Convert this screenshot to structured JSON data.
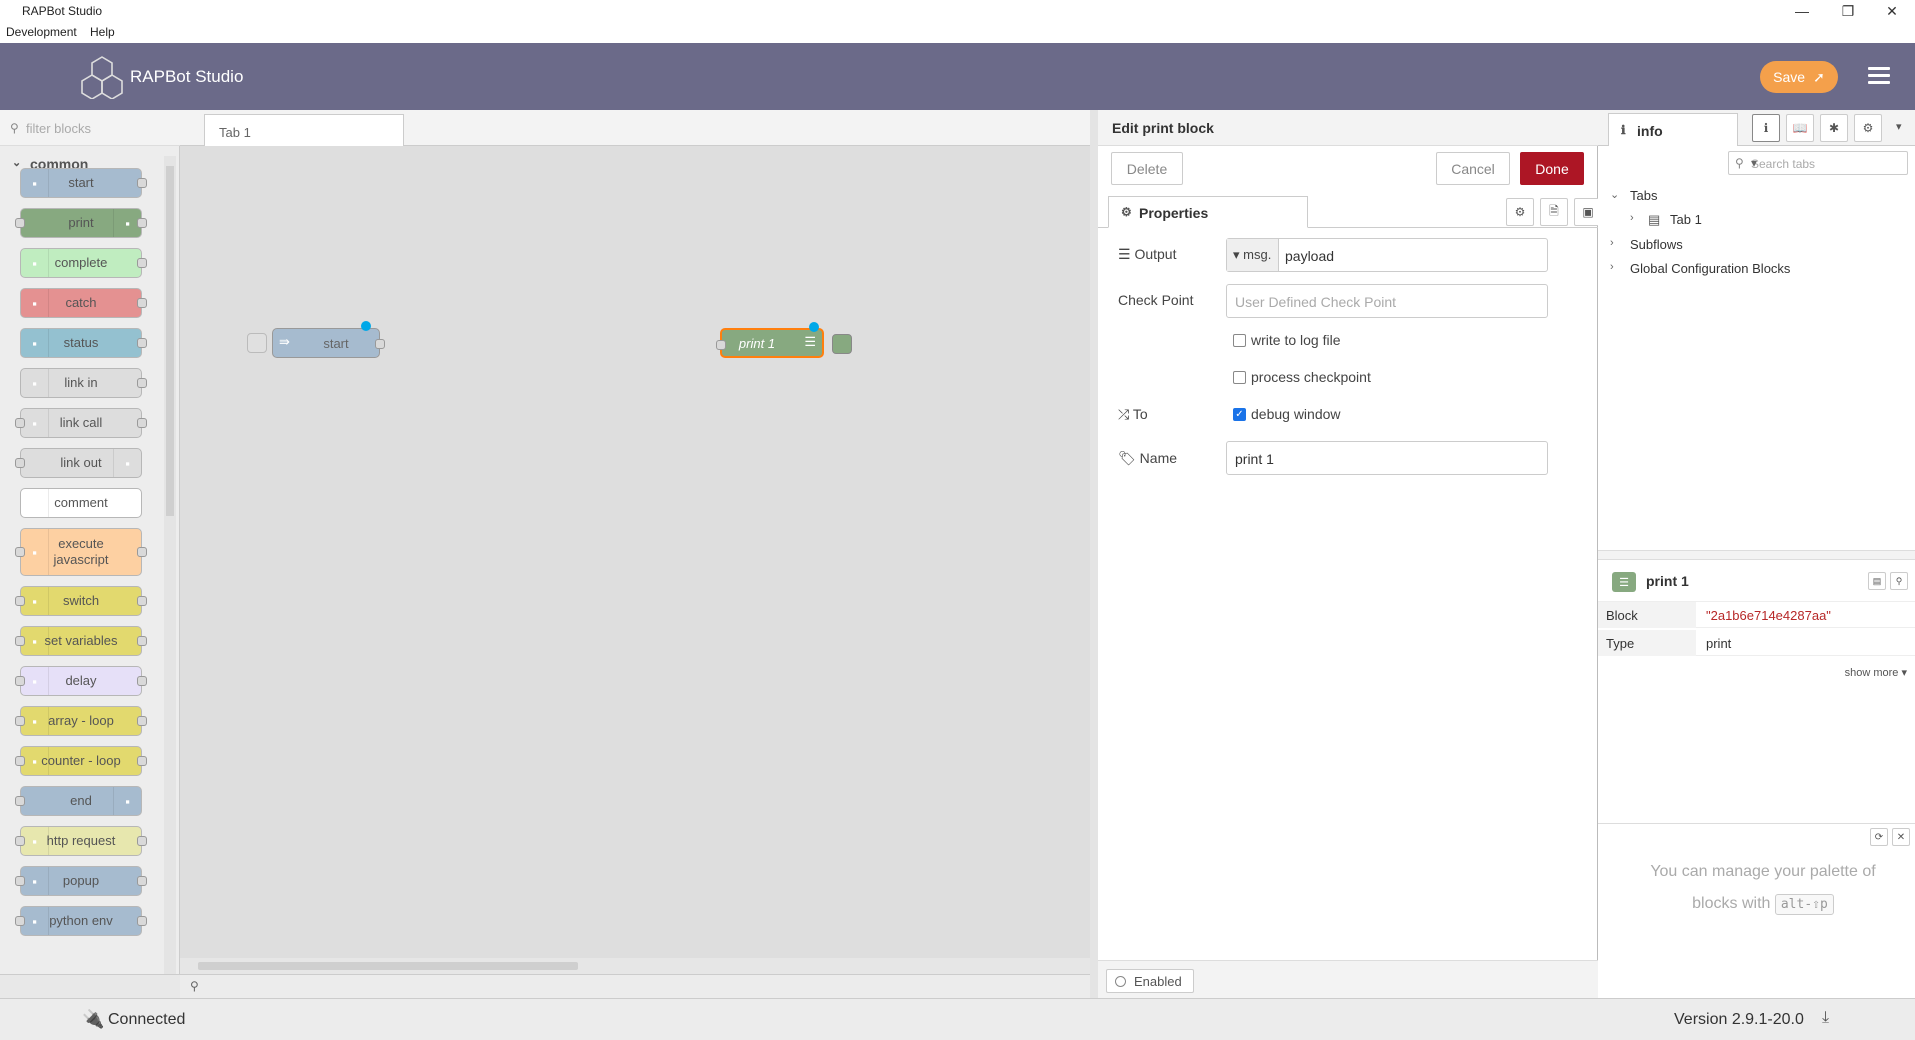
{
  "window": {
    "title": "RAPBot Studio",
    "minimize": "—",
    "restore": "❐",
    "close": "✕"
  },
  "menubar": {
    "items": [
      "Development",
      "Help"
    ]
  },
  "header": {
    "app_title": "RAPBot Studio",
    "save_label": "Save"
  },
  "palette": {
    "filter_placeholder": "filter blocks",
    "category": "common",
    "nodes": [
      {
        "label": "start",
        "color": "#a6bbcf"
      },
      {
        "label": "print",
        "color": "#87a980"
      },
      {
        "label": "complete",
        "color": "#c0edc0"
      },
      {
        "label": "catch",
        "color": "#e49191"
      },
      {
        "label": "status",
        "color": "#94c1d0"
      },
      {
        "label": "link in",
        "color": "#dddddd"
      },
      {
        "label": "link call",
        "color": "#dddddd"
      },
      {
        "label": "link out",
        "color": "#dddddd"
      },
      {
        "label": "comment",
        "color": "#ffffff"
      },
      {
        "label": "execute javascript",
        "color": "#fdd0a2"
      },
      {
        "label": "switch",
        "color": "#e2d96e"
      },
      {
        "label": "set variables",
        "color": "#e2d96e"
      },
      {
        "label": "delay",
        "color": "#e6e0f8"
      },
      {
        "label": "array - loop",
        "color": "#e2d96e"
      },
      {
        "label": "counter - loop",
        "color": "#e2d96e"
      },
      {
        "label": "end",
        "color": "#a6bbcf"
      },
      {
        "label": "http request",
        "color": "#e7e7ae"
      },
      {
        "label": "popup",
        "color": "#a6bbcf"
      },
      {
        "label": "python env",
        "color": "#a6bbcf"
      }
    ]
  },
  "workspace": {
    "tab": "Tab 1",
    "nodes": [
      {
        "label": "start"
      },
      {
        "label": "print 1"
      }
    ]
  },
  "editor": {
    "title": "Edit print block",
    "delete_label": "Delete",
    "cancel_label": "Cancel",
    "done_label": "Done",
    "properties_tab": "Properties",
    "output_label": "Output",
    "output_prefix": "msg.",
    "output_value": "payload",
    "checkpoint_label": "Check Point",
    "checkpoint_placeholder": "User Defined Check Point",
    "write_log_label": "write to log file",
    "process_checkpoint_label": "process checkpoint",
    "to_label": "To",
    "debug_window_label": "debug window",
    "name_label": "Name",
    "name_value": "print 1",
    "enabled_label": "Enabled"
  },
  "sidebar": {
    "tab": "info",
    "search_placeholder": "Search tabs",
    "tree": {
      "tabs": "Tabs",
      "tab1": "Tab 1",
      "subflows": "Subflows",
      "global": "Global Configuration Blocks"
    },
    "node_name": "print 1",
    "props": [
      {
        "k": "Block",
        "v": "\"2a1b6e714e4287aa\""
      },
      {
        "k": "Type",
        "v": "print"
      }
    ],
    "show_more": "show more ▾",
    "help_text_1": "You can manage your palette of",
    "help_text_2": "blocks with",
    "help_kbd": "alt-⇧p"
  },
  "status": {
    "connected": "Connected",
    "version": "Version 2.9.1-20.0"
  }
}
